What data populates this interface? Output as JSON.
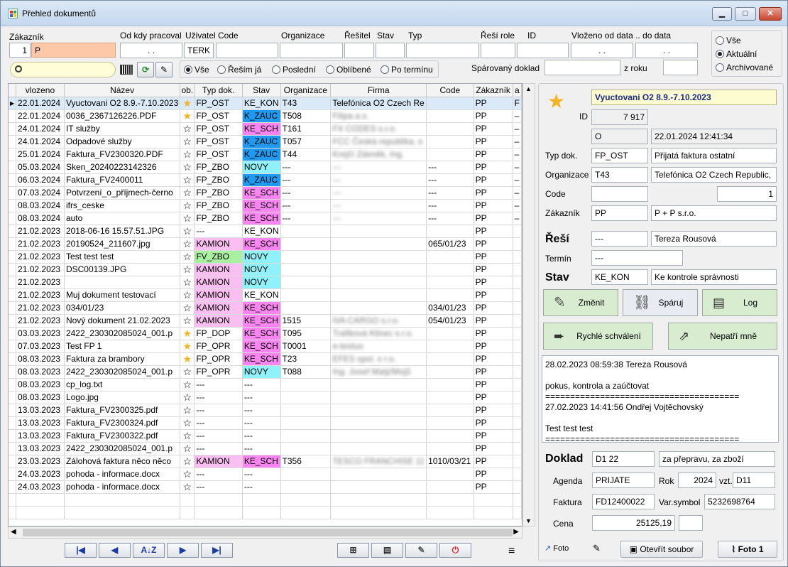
{
  "window": {
    "title": "Přehled dokumentů",
    "min": "▁",
    "max": "□",
    "close": "✕"
  },
  "filters": {
    "zakaznik_label": "Zákazník",
    "zakaznik_num": "1",
    "zakaznik_val": "P",
    "od_kdy_label": "Od kdy pracoval",
    "od_kdy_val": ". .",
    "uzivatel_label": "Uživatel",
    "uzivatel_val": "TERK",
    "code_label": "Code",
    "organizace_label": "Organizace",
    "resitel_label": "Řešitel",
    "stav_label": "Stav",
    "typ_label": "Typ",
    "resi_role_label": "Řeší role",
    "id_label": "ID",
    "vlozeno_label": "Vloženo od data .. do data",
    "vlozeno_od": ". .",
    "vlozeno_do": ". .",
    "radio_all": "Vše",
    "radio_resim": "Řeším já",
    "radio_posledni": "Poslední",
    "radio_oblibene": "Oblíbené",
    "radio_termin": "Po termínu",
    "sparovany_label": "Spárovaný doklad",
    "z_roku_label": "z roku",
    "scope_all": "Vše",
    "scope_actual": "Aktuální",
    "scope_archive": "Archivované"
  },
  "grid": {
    "columns": [
      "vlozeno",
      "Název",
      "ob.",
      "Typ dok.",
      "Stav",
      "Organizace",
      "Firma",
      "Code",
      "Zákazník",
      "a"
    ],
    "rows": [
      {
        "d": "22.01.2024",
        "n": "Vyuctovani O2 8.9.-7.10.2023",
        "s": "★",
        "t": "FP_OST",
        "st": "KE_KON",
        "o": "T43",
        "f": "Telefónica O2 Czech Re",
        "c": "",
        "z": "PP",
        "a": "F",
        "sel": true
      },
      {
        "d": "22.01.2024",
        "n": "0036_2367126226.PDF",
        "s": "★",
        "t": "FP_OST",
        "st": "K_ZAUC",
        "o": "T508",
        "f": "Filipa a.s.",
        "c": "",
        "z": "PP",
        "a": "–",
        "blur": true
      },
      {
        "d": "24.01.2024",
        "n": "IT služby",
        "s": "☆",
        "t": "FP_OST",
        "st": "KE_SCH",
        "o": "T161",
        "f": "FX CODES s.r.o.",
        "c": "",
        "z": "PP",
        "a": "–",
        "blur": true
      },
      {
        "d": "24.01.2024",
        "n": "Odpadové služby",
        "s": "☆",
        "t": "FP_OST",
        "st": "K_ZAUC",
        "o": "T057",
        "f": "FCC Česká republika, s",
        "c": "",
        "z": "PP",
        "a": "–",
        "blur": true
      },
      {
        "d": "25.01.2024",
        "n": "Faktura_FV2300320.PDF",
        "s": "☆",
        "t": "FP_OST",
        "st": "K_ZAUC",
        "o": "T44",
        "f": "Krejčí Zdeněk, Ing.",
        "c": "",
        "z": "PP",
        "a": "–",
        "blur": true
      },
      {
        "d": "05.03.2024",
        "n": "Sken_20240223142326",
        "s": "☆",
        "t": "FP_ZBO",
        "st": "NOVY",
        "o": "---",
        "f": "---",
        "c": "---",
        "z": "PP",
        "a": "–",
        "blur": true
      },
      {
        "d": "06.03.2024",
        "n": "Faktura_FV2400011",
        "s": "☆",
        "t": "FP_ZBO",
        "st": "K_ZAUC",
        "o": "---",
        "f": "---",
        "c": "---",
        "z": "PP",
        "a": "–",
        "blur": true
      },
      {
        "d": "07.03.2024",
        "n": "Potvrzení_o_příjmech-černo",
        "s": "☆",
        "t": "FP_ZBO",
        "st": "KE_SCH",
        "o": "---",
        "f": "---",
        "c": "---",
        "z": "PP",
        "a": "–",
        "blur": true
      },
      {
        "d": "08.03.2024",
        "n": "ifrs_ceske",
        "s": "☆",
        "t": "FP_ZBO",
        "st": "KE_SCH",
        "o": "---",
        "f": "---",
        "c": "---",
        "z": "PP",
        "a": "–",
        "blur": true
      },
      {
        "d": "08.03.2024",
        "n": "auto",
        "s": "☆",
        "t": "FP_ZBO",
        "st": "KE_SCH",
        "o": "---",
        "f": "---",
        "c": "---",
        "z": "PP",
        "a": "–",
        "blur": true
      },
      {
        "d": "21.02.2023",
        "n": "2018-06-16 15.57.51.JPG",
        "s": "☆",
        "t": "---",
        "st": "KE_KON",
        "o": "",
        "f": "",
        "c": "",
        "z": "PP",
        "a": ""
      },
      {
        "d": "21.02.2023",
        "n": "20190524_211607.jpg",
        "s": "☆",
        "t": "KAMION",
        "st": "KE_SCH",
        "o": "",
        "f": "",
        "c": "065/01/23",
        "z": "PP",
        "a": ""
      },
      {
        "d": "21.02.2023",
        "n": "Test test test",
        "s": "☆",
        "t": "FV_ZBO",
        "st": "NOVY",
        "o": "",
        "f": "",
        "c": "",
        "z": "PP",
        "a": ""
      },
      {
        "d": "21.02.2023",
        "n": "DSC00139.JPG",
        "s": "☆",
        "t": "KAMION",
        "st": "NOVY",
        "o": "",
        "f": "",
        "c": "",
        "z": "PP",
        "a": ""
      },
      {
        "d": "21.02.2023",
        "n": "",
        "s": "☆",
        "t": "KAMION",
        "st": "NOVY",
        "o": "",
        "f": "",
        "c": "",
        "z": "PP",
        "a": ""
      },
      {
        "d": "21.02.2023",
        "n": "Muj dokument testovací",
        "s": "☆",
        "t": "KAMION",
        "st": "KE_KON",
        "o": "",
        "f": "",
        "c": "",
        "z": "PP",
        "a": ""
      },
      {
        "d": "21.02.2023",
        "n": "034/01/23",
        "s": "☆",
        "t": "KAMION",
        "st": "KE_SCH",
        "o": "",
        "f": "",
        "c": "034/01/23",
        "z": "PP",
        "a": ""
      },
      {
        "d": "21.02.2023",
        "n": "Nový dokument 21.02.2023",
        "s": "☆",
        "t": "KAMION",
        "st": "KE_SCH",
        "o": "1515",
        "f": "IVA CARGO s.r.o.",
        "c": "054/01/23",
        "z": "PP",
        "a": "",
        "blur": true
      },
      {
        "d": "03.03.2023",
        "n": "2422_230302085024_001.p",
        "s": "★",
        "t": "FP_DOP",
        "st": "KE_SCH",
        "o": "T095",
        "f": "Trafiková Klinec s.r.o.",
        "c": "",
        "z": "PP",
        "a": "",
        "blur": true
      },
      {
        "d": "07.03.2023",
        "n": "Test FP 1",
        "s": "★",
        "t": "FP_OPR",
        "st": "KE_SCH",
        "o": "T0001",
        "f": "e-testuo",
        "c": "",
        "z": "PP",
        "a": "",
        "blur": true
      },
      {
        "d": "08.03.2023",
        "n": "Faktura za brambory",
        "s": "★",
        "t": "FP_OPR",
        "st": "KE_SCH",
        "o": "T23",
        "f": "EFES spol. s r.o.",
        "c": "",
        "z": "PP",
        "a": "",
        "blur": true
      },
      {
        "d": "08.03.2023",
        "n": "2422_230302085024_001.p",
        "s": "☆",
        "t": "FP_OPR",
        "st": "NOVY",
        "o": "T088",
        "f": "Ing. Josef Malý/Mojů",
        "c": "",
        "z": "PP",
        "a": "",
        "blur": true
      },
      {
        "d": "08.03.2023",
        "n": "cp_log.txt",
        "s": "☆",
        "t": "---",
        "st": "---",
        "o": "",
        "f": "",
        "c": "",
        "z": "PP",
        "a": ""
      },
      {
        "d": "08.03.2023",
        "n": "Logo.jpg",
        "s": "☆",
        "t": "---",
        "st": "---",
        "o": "",
        "f": "",
        "c": "",
        "z": "PP",
        "a": ""
      },
      {
        "d": "13.03.2023",
        "n": "Faktura_FV2300325.pdf",
        "s": "☆",
        "t": "---",
        "st": "---",
        "o": "",
        "f": "",
        "c": "",
        "z": "PP",
        "a": ""
      },
      {
        "d": "13.03.2023",
        "n": "Faktura_FV2300324.pdf",
        "s": "☆",
        "t": "---",
        "st": "---",
        "o": "",
        "f": "",
        "c": "",
        "z": "PP",
        "a": ""
      },
      {
        "d": "13.03.2023",
        "n": "Faktura_FV2300322.pdf",
        "s": "☆",
        "t": "---",
        "st": "---",
        "o": "",
        "f": "",
        "c": "",
        "z": "PP",
        "a": ""
      },
      {
        "d": "13.03.2023",
        "n": "2422_230302085024_001.p",
        "s": "☆",
        "t": "---",
        "st": "---",
        "o": "",
        "f": "",
        "c": "",
        "z": "PP",
        "a": ""
      },
      {
        "d": "23.03.2023",
        "n": "Zálohová faktura něco něco",
        "s": "☆",
        "t": "KAMION",
        "st": "KE_SCH",
        "o": "T356",
        "f": "TESCO FRANCHISE 11",
        "c": "1010/03/21",
        "z": "PP",
        "a": "",
        "blur": true
      },
      {
        "d": "24.03.2023",
        "n": "pohoda - informace.docx",
        "s": "☆",
        "t": "---",
        "st": "---",
        "o": "",
        "f": "",
        "c": "",
        "z": "PP",
        "a": ""
      },
      {
        "d": "24.03.2023",
        "n": "pohoda - informace.docx",
        "s": "☆",
        "t": "---",
        "st": "---",
        "o": "",
        "f": "",
        "c": "",
        "z": "PP",
        "a": ""
      }
    ]
  },
  "colors": {
    "KE_SCH": "#f986f0",
    "K_ZAUC": "#1f9af0",
    "NOVY": "#8ff2fb",
    "KAMION": "#f9bff0",
    "FV_ZBO": "#a9f0a0",
    "star": "#f3b323",
    "btn_green": "#d8ecd0"
  },
  "detail": {
    "title": "Vyuctovani O2 8.9.-7.10.2023",
    "id_label": "ID",
    "id_val": "7 917",
    "flag": "O",
    "datetime": "22.01.2024 12:41:34",
    "typ_label": "Typ dok.",
    "typ_code": "FP_OST",
    "typ_name": "Přijatá faktura ostatní",
    "org_label": "Organizace",
    "org_code": "T43",
    "org_name": "Telefónica O2 Czech Republic,",
    "code_label": "Code",
    "code_num": "1",
    "zak_label": "Zákazník",
    "zak_code": "PP",
    "zak_name": "P + P s.r.o.",
    "resi_label": "Řeší",
    "resi_code": "---",
    "resi_name": "Tereza Rousová",
    "termin_label": "Termín",
    "termin_val": "---",
    "stav_label": "Stav",
    "stav_code": "KE_KON",
    "stav_name": "Ke kontrole správnosti",
    "btn_zmenit": "Změnit",
    "btn_sparuj": "Spáruj",
    "btn_log": "Log",
    "btn_rychle": "Rychlé schválení",
    "btn_nepatri": "Nepatří mně",
    "log_text": "28.02.2023 08:59:38 Tereza Rousová\n\npokus, kontrola a zaúčtovat\n=======================================\n27.02.2023 14:41:56 Ondřej Vojtěchovský\n\nTest test test\n=======================================",
    "doklad_label": "Doklad",
    "doklad_val": "D1   22",
    "doklad_desc": "za přepravu, za zboží",
    "agenda_label": "Agenda",
    "agenda_val": "PRIJATE",
    "rok_label": "Rok",
    "rok_val": "2024",
    "vzt_label": "vzt.",
    "vzt_val": "D11",
    "faktura_label": "Faktura",
    "faktura_val": "FD12400022",
    "varsym_label": "Var.symbol",
    "varsym_val": "5232698764",
    "cena_label": "Cena",
    "cena_val": "25125,19",
    "foto_label": "Foto",
    "otevrit_label": "Otevřít soubor",
    "foto1_label": "Foto 1"
  }
}
